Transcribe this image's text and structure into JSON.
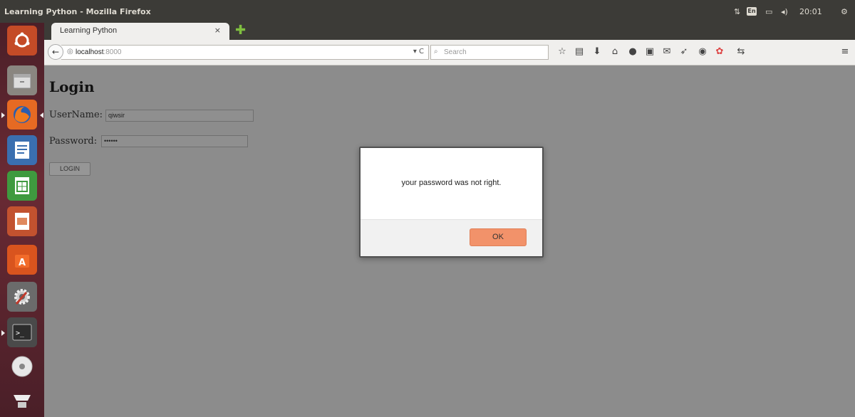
{
  "system_panel": {
    "window_title": "Learning Python - Mozilla Firefox",
    "keyboard_layout": "En",
    "clock": "20:01",
    "icons": [
      "network-icon",
      "keyboard-icon",
      "battery-icon",
      "volume-icon",
      "power-gear-icon"
    ]
  },
  "launcher": {
    "items": [
      {
        "name": "ubuntu-dash-icon"
      },
      {
        "name": "files-icon"
      },
      {
        "name": "firefox-icon"
      },
      {
        "name": "writer-icon"
      },
      {
        "name": "calc-icon"
      },
      {
        "name": "impress-icon"
      },
      {
        "name": "software-center-icon"
      },
      {
        "name": "system-settings-icon"
      },
      {
        "name": "terminal-icon"
      },
      {
        "name": "disc-icon"
      },
      {
        "name": "drive-icon"
      }
    ]
  },
  "browser": {
    "tab_title": "Learning Python",
    "tab_close": "×",
    "new_tab": "✚",
    "url_host": "localhost",
    "url_port": ":8000",
    "url_reload": "▾ C",
    "search_placeholder": "Search",
    "toolbar_icons": [
      "bookmark-star-icon",
      "reading-list-icon",
      "download-icon",
      "home-icon",
      "chat-icon",
      "youtube-icon",
      "speech-icon",
      "send-icon",
      "shield-icon",
      "addon-icon",
      "sync-icon",
      "menu-icon"
    ]
  },
  "page": {
    "heading": "Login",
    "username_label": "UserName:",
    "username_value": "qiwsir",
    "password_label": "Password:",
    "password_value": "••••••",
    "login_button": "LOGIN"
  },
  "dialog": {
    "message": "your password was not right.",
    "ok_button": "OK"
  },
  "colors": {
    "panel": "#3c3b37",
    "launcher": "#6a2a34",
    "page_overlay": "#8c8c8c",
    "ok_button": "#f2926a"
  }
}
